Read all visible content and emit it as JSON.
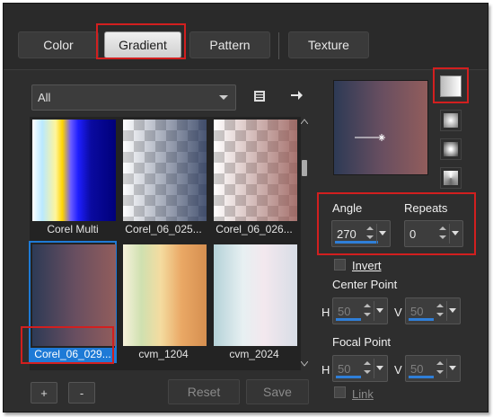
{
  "tabs": [
    {
      "label": "Color"
    },
    {
      "label": "Gradient"
    },
    {
      "label": "Pattern"
    },
    {
      "label": "Texture"
    }
  ],
  "category_select": {
    "value": "All"
  },
  "gradients": [
    {
      "label": "Corel Multi"
    },
    {
      "label": "Corel_06_025..."
    },
    {
      "label": "Corel_06_026..."
    },
    {
      "label": "Corel_06_029..."
    },
    {
      "label": "cvm_1204"
    },
    {
      "label": "cvm_2024"
    }
  ],
  "buttons": {
    "add": "+",
    "remove": "-",
    "reset": "Reset",
    "save": "Save"
  },
  "angle": {
    "label": "Angle",
    "value": "270"
  },
  "repeats": {
    "label": "Repeats",
    "value": "0"
  },
  "invert": {
    "label": "Invert"
  },
  "center_point": {
    "label": "Center Point",
    "h_label": "H",
    "h_value": "50",
    "v_label": "V",
    "v_value": "50"
  },
  "focal_point": {
    "label": "Focal Point",
    "h_label": "H",
    "h_value": "50",
    "v_label": "V",
    "v_value": "50"
  },
  "link": {
    "label": "Link"
  },
  "colors": {
    "accent": "#1e7ad6",
    "highlight": "#d21f1f",
    "background": "#2e2e2e"
  },
  "icons": [
    "gradient-folder-icon",
    "arrow-right-icon",
    "linear-style-icon",
    "rectangular-style-icon",
    "radial-style-icon",
    "sunburst-style-icon",
    "caret-down-icon"
  ]
}
